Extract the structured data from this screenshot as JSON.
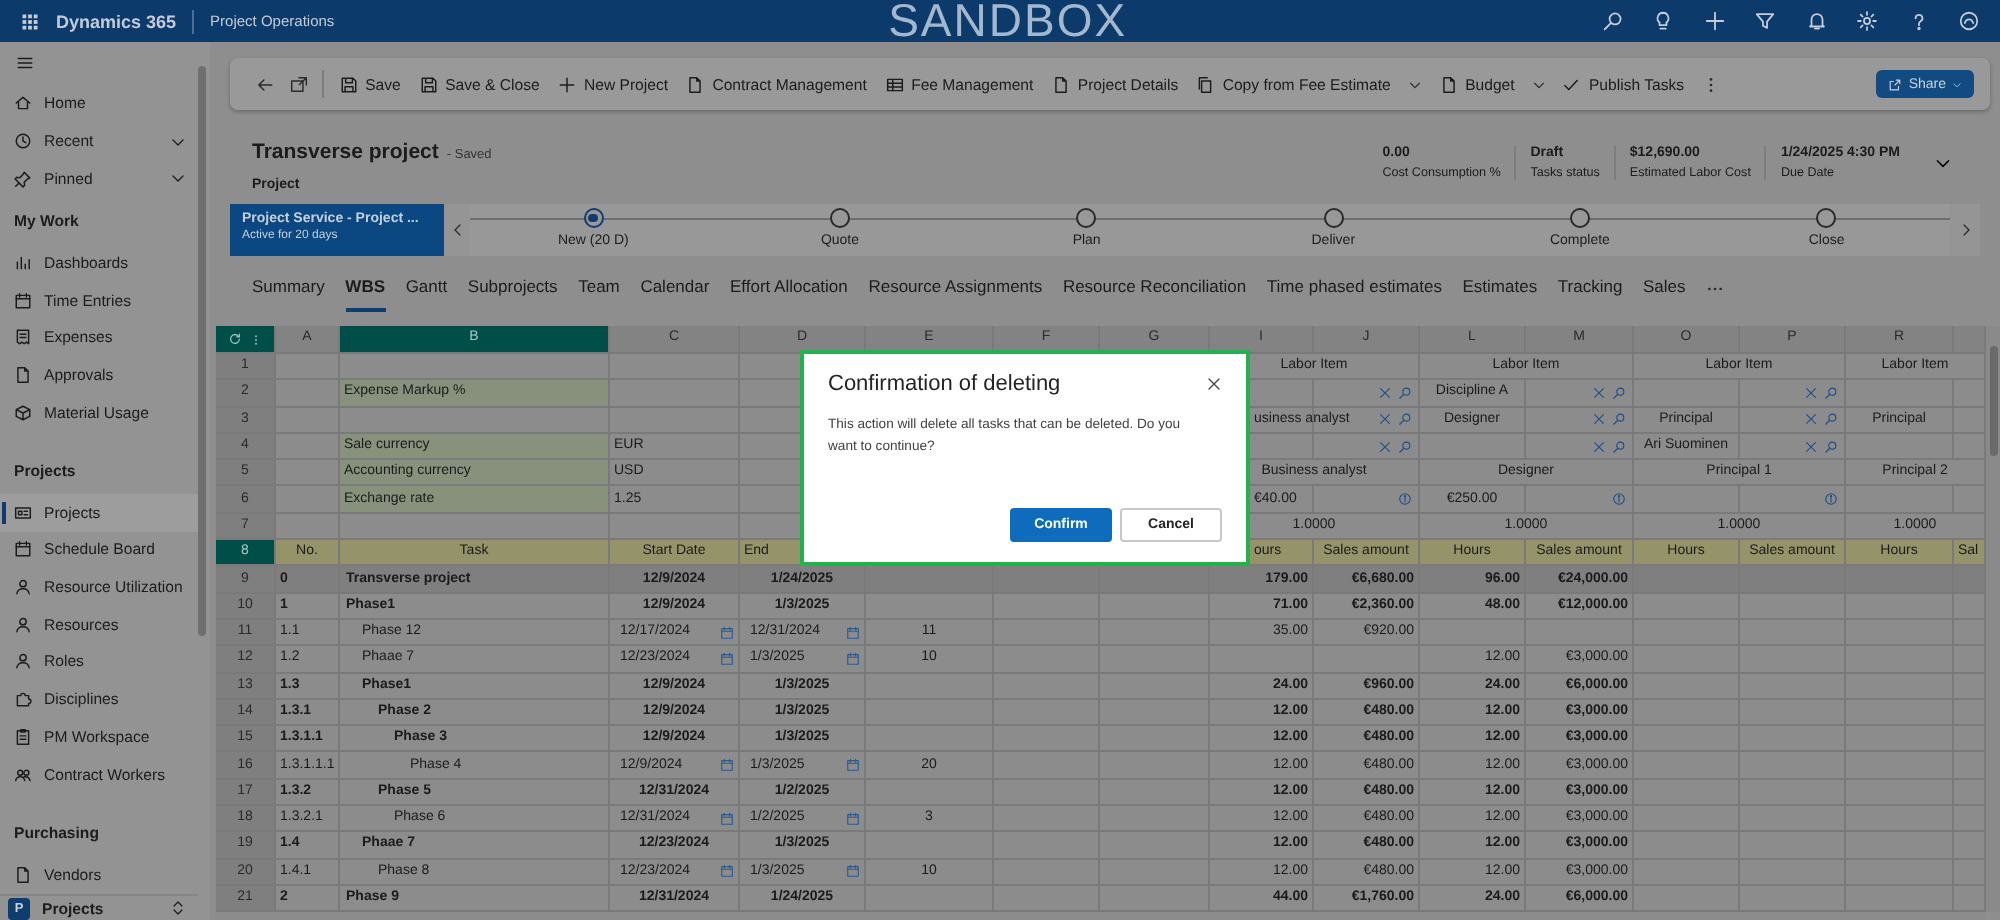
{
  "top_bar": {
    "app_name": "Dynamics 365",
    "area": "Project Operations",
    "environment": "SANDBOX"
  },
  "sidebar": {
    "items": [
      {
        "kind": "item",
        "label": "Home",
        "selected": false
      },
      {
        "kind": "expander",
        "label": "Recent",
        "selected": false
      },
      {
        "kind": "expander",
        "label": "Pinned",
        "selected": false
      },
      {
        "kind": "heading",
        "label": "My Work"
      },
      {
        "kind": "item",
        "label": "Dashboards",
        "selected": false
      },
      {
        "kind": "item",
        "label": "Time Entries",
        "selected": false
      },
      {
        "kind": "item",
        "label": "Expenses",
        "selected": false
      },
      {
        "kind": "item",
        "label": "Approvals",
        "selected": false
      },
      {
        "kind": "item",
        "label": "Material Usage",
        "selected": false
      },
      {
        "kind": "heading",
        "label": "Projects"
      },
      {
        "kind": "item",
        "label": "Projects",
        "selected": true
      },
      {
        "kind": "item",
        "label": "Schedule Board",
        "selected": false
      },
      {
        "kind": "item",
        "label": "Resource Utilization",
        "selected": false
      },
      {
        "kind": "item",
        "label": "Resources",
        "selected": false
      },
      {
        "kind": "item",
        "label": "Roles",
        "selected": false
      },
      {
        "kind": "item",
        "label": "Disciplines",
        "selected": false
      },
      {
        "kind": "item",
        "label": "PM Workspace",
        "selected": false
      },
      {
        "kind": "item",
        "label": "Contract Workers",
        "selected": false
      },
      {
        "kind": "heading",
        "label": "Purchasing"
      },
      {
        "kind": "item",
        "label": "Vendors",
        "selected": false
      }
    ],
    "area_switcher": {
      "initial": "P",
      "label": "Projects"
    }
  },
  "command_bar": {
    "commands": [
      {
        "label": "Save",
        "kind": "button"
      },
      {
        "label": "Save & Close",
        "kind": "button"
      },
      {
        "label": "New Project",
        "kind": "button"
      },
      {
        "label": "Contract Management",
        "kind": "button"
      },
      {
        "label": "Fee Management",
        "kind": "button"
      },
      {
        "label": "Project Details",
        "kind": "button"
      },
      {
        "label": "Copy from Fee Estimate",
        "kind": "split"
      },
      {
        "label": "Budget",
        "kind": "split"
      },
      {
        "label": "Publish Tasks",
        "kind": "button"
      }
    ],
    "share": "Share"
  },
  "record": {
    "title": "Transverse project",
    "save_state": "- Saved",
    "entity": "Project",
    "fields": [
      {
        "value": "0.00",
        "label": "Cost Consumption %"
      },
      {
        "value": "Draft",
        "label": "Tasks status"
      },
      {
        "value": "$12,690.00",
        "label": "Estimated Labor Cost"
      },
      {
        "value": "1/24/2025 4:30 PM",
        "label": "Due Date"
      }
    ]
  },
  "process": {
    "active_process": "Project Service - Project ...",
    "active_for": "Active for 20 days",
    "stages": [
      {
        "label": "New (20 D)",
        "selected": true
      },
      {
        "label": "Quote",
        "selected": false
      },
      {
        "label": "Plan",
        "selected": false
      },
      {
        "label": "Deliver",
        "selected": false
      },
      {
        "label": "Complete",
        "selected": false
      },
      {
        "label": "Close",
        "selected": false
      }
    ]
  },
  "tabs": [
    {
      "label": "Summary",
      "selected": false
    },
    {
      "label": "WBS",
      "selected": true
    },
    {
      "label": "Gantt",
      "selected": false
    },
    {
      "label": "Subprojects",
      "selected": false
    },
    {
      "label": "Team",
      "selected": false
    },
    {
      "label": "Calendar",
      "selected": false
    },
    {
      "label": "Effort Allocation",
      "selected": false
    },
    {
      "label": "Resource Assignments",
      "selected": false
    },
    {
      "label": "Resource Reconciliation",
      "selected": false
    },
    {
      "label": "Time phased estimates",
      "selected": false
    },
    {
      "label": "Estimates",
      "selected": false
    },
    {
      "label": "Tracking",
      "selected": false
    },
    {
      "label": "Sales",
      "selected": false
    }
  ],
  "grid": {
    "columns": [
      {
        "letter": "A",
        "selected": false
      },
      {
        "letter": "B",
        "selected": true
      },
      {
        "letter": "C",
        "selected": false
      },
      {
        "letter": "D",
        "selected": false
      },
      {
        "letter": "E",
        "selected": false
      },
      {
        "letter": "F",
        "selected": false
      },
      {
        "letter": "G",
        "selected": false
      },
      {
        "letter": "I",
        "selected": false
      },
      {
        "letter": "J",
        "selected": false
      },
      {
        "letter": "L",
        "selected": false
      },
      {
        "letter": "M",
        "selected": false
      },
      {
        "letter": "O",
        "selected": false
      },
      {
        "letter": "P",
        "selected": false
      },
      {
        "letter": "R",
        "selected": false
      }
    ],
    "rows": [
      {
        "row": "1",
        "selected": false,
        "kind": "plain",
        "cells": [
          null,
          null,
          null,
          null,
          null,
          null,
          null,
          {
            "kind": "wide",
            "text": "Labor Item"
          },
          {
            "kind": "wide",
            "text": "Labor Item"
          },
          {
            "kind": "wide",
            "text": "Labor Item"
          },
          {
            "kind": "wide",
            "text": "Labor Item"
          }
        ]
      },
      {
        "row": "2",
        "selected": false,
        "kind": "plain",
        "cells": [
          null,
          {
            "kind": "label",
            "text": "Expense Markup %"
          },
          null,
          null,
          null,
          null,
          null,
          null,
          {
            "kind": "lookup"
          },
          {
            "kind": "text",
            "text": "Discipline A"
          },
          {
            "kind": "lookup"
          },
          null,
          {
            "kind": "lookup"
          }
        ]
      },
      {
        "row": "3",
        "selected": false,
        "kind": "plain",
        "cells": [
          null,
          null,
          null,
          null,
          null,
          null,
          null,
          {
            "kind": "clipped",
            "text": "usiness analyst"
          },
          {
            "kind": "lookup"
          },
          {
            "kind": "text",
            "text": "Designer"
          },
          {
            "kind": "lookup"
          },
          {
            "kind": "text",
            "text": "Principal"
          },
          {
            "kind": "lookup"
          },
          {
            "kind": "text",
            "text": "Principal"
          }
        ]
      },
      {
        "row": "4",
        "selected": false,
        "kind": "plain",
        "cells": [
          null,
          {
            "kind": "label",
            "text": "Sale currency"
          },
          {
            "kind": "text",
            "text": "EUR"
          },
          null,
          null,
          null,
          null,
          null,
          {
            "kind": "lookup"
          },
          null,
          {
            "kind": "lookup"
          },
          {
            "kind": "text",
            "text": "Ari Suominen"
          },
          {
            "kind": "lookup"
          }
        ]
      },
      {
        "row": "5",
        "selected": false,
        "kind": "plain",
        "cells": [
          null,
          {
            "kind": "label",
            "text": "Accounting currency"
          },
          {
            "kind": "text",
            "text": "USD"
          },
          null,
          null,
          null,
          null,
          {
            "kind": "wide",
            "text": "Business analyst"
          },
          {
            "kind": "wide",
            "text": "Designer"
          },
          {
            "kind": "wide",
            "text": "Principal 1"
          },
          {
            "kind": "wide",
            "text": "Principal 2"
          }
        ]
      },
      {
        "row": "6",
        "selected": false,
        "kind": "plain",
        "cells": [
          null,
          {
            "kind": "label",
            "text": "Exchange rate"
          },
          {
            "kind": "text",
            "text": "1.25"
          },
          null,
          null,
          null,
          null,
          {
            "kind": "clipped",
            "text": "€40.00"
          },
          {
            "kind": "info"
          },
          {
            "kind": "text",
            "text": "€250.00"
          },
          {
            "kind": "info"
          },
          null,
          {
            "kind": "info"
          }
        ]
      },
      {
        "row": "7",
        "selected": false,
        "kind": "plain",
        "cells": [
          null,
          null,
          null,
          null,
          null,
          null,
          null,
          {
            "kind": "wide",
            "text": "1.0000"
          },
          {
            "kind": "wide",
            "text": "1.0000"
          },
          {
            "kind": "wide",
            "text": "1.0000"
          },
          {
            "kind": "wide",
            "text": "1.0000"
          }
        ]
      },
      {
        "row": "8",
        "selected": true,
        "kind": "header",
        "cells": [
          {
            "kind": "text",
            "text": "No."
          },
          {
            "kind": "text",
            "text": "Task"
          },
          {
            "kind": "text",
            "text": "Start Date"
          },
          {
            "kind": "partial",
            "text": "End"
          },
          null,
          null,
          null,
          {
            "kind": "clipped",
            "text": "ours"
          },
          {
            "kind": "text",
            "text": "Sales amount"
          },
          {
            "kind": "text",
            "text": "Hours"
          },
          {
            "kind": "text",
            "text": "Sales amount"
          },
          {
            "kind": "text",
            "text": "Hours"
          },
          {
            "kind": "text",
            "text": "Sales amount"
          },
          {
            "kind": "text",
            "text": "Hours"
          },
          {
            "kind": "partial",
            "text": "Sal"
          }
        ]
      }
    ],
    "tasks": [
      {
        "row": "9",
        "selected": false,
        "kind": "project",
        "no": "0",
        "task": "Transverse project",
        "start": "12/9/2024",
        "end": "1/24/2025",
        "hours": "179.00",
        "sales": "€6,680.00",
        "hours_2": "96.00",
        "sales_2": "€24,000.00",
        "children": [
          {
            "row": "10",
            "selected": false,
            "kind": "summary",
            "no": "1",
            "task": "Phase1",
            "start": "12/9/2024",
            "end": "1/3/2025",
            "hours": "71.00",
            "sales": "€2,360.00",
            "hours_2": "48.00",
            "sales_2": "€12,000.00",
            "children": [
              {
                "row": "11",
                "selected": false,
                "kind": "task",
                "no": "1.1",
                "task": "Phase 12",
                "start": "12/17/2024",
                "end": "12/31/2024",
                "column_e": "11",
                "hours": "35.00",
                "sales": "€920.00"
              },
              {
                "row": "12",
                "selected": false,
                "kind": "task",
                "no": "1.2",
                "task": "Phaae 7",
                "start": "12/23/2024",
                "end": "1/3/2025",
                "column_e": "10",
                "hours_2": "12.00",
                "sales_2": "€3,000.00"
              },
              {
                "row": "13",
                "selected": false,
                "kind": "summary",
                "no": "1.3",
                "task": "Phase1",
                "start": "12/9/2024",
                "end": "1/3/2025",
                "hours": "24.00",
                "sales": "€960.00",
                "hours_2": "24.00",
                "sales_2": "€6,000.00",
                "children": [
                  {
                    "row": "14",
                    "selected": false,
                    "kind": "summary",
                    "no": "1.3.1",
                    "task": "Phase 2",
                    "start": "12/9/2024",
                    "end": "1/3/2025",
                    "hours": "12.00",
                    "sales": "€480.00",
                    "hours_2": "12.00",
                    "sales_2": "€3,000.00",
                    "children": [
                      {
                        "row": "15",
                        "selected": false,
                        "kind": "summary",
                        "no": "1.3.1.1",
                        "task": "Phase 3",
                        "start": "12/9/2024",
                        "end": "1/3/2025",
                        "hours": "12.00",
                        "sales": "€480.00",
                        "hours_2": "12.00",
                        "sales_2": "€3,000.00",
                        "children": [
                          {
                            "row": "16",
                            "selected": false,
                            "kind": "task",
                            "no": "1.3.1.1.1",
                            "task": "Phase 4",
                            "start": "12/9/2024",
                            "end": "1/3/2025",
                            "column_e": "20",
                            "hours": "12.00",
                            "sales": "€480.00",
                            "hours_2": "12.00",
                            "sales_2": "€3,000.00"
                          }
                        ]
                      }
                    ]
                  },
                  {
                    "row": "17",
                    "selected": false,
                    "kind": "summary",
                    "no": "1.3.2",
                    "task": "Phase 5",
                    "start": "12/31/2024",
                    "end": "1/2/2025",
                    "hours": "12.00",
                    "sales": "€480.00",
                    "hours_2": "12.00",
                    "sales_2": "€3,000.00",
                    "children": [
                      {
                        "row": "18",
                        "selected": false,
                        "kind": "task",
                        "no": "1.3.2.1",
                        "task": "Phase 6",
                        "start": "12/31/2024",
                        "end": "1/2/2025",
                        "column_e": "3",
                        "hours": "12.00",
                        "sales": "€480.00",
                        "hours_2": "12.00",
                        "sales_2": "€3,000.00"
                      }
                    ]
                  }
                ]
              },
              {
                "row": "19",
                "selected": false,
                "kind": "summary",
                "no": "1.4",
                "task": "Phaae 7",
                "start": "12/23/2024",
                "end": "1/3/2025",
                "hours": "12.00",
                "sales": "€480.00",
                "hours_2": "12.00",
                "sales_2": "€3,000.00",
                "children": [
                  {
                    "row": "20",
                    "selected": false,
                    "kind": "task",
                    "no": "1.4.1",
                    "task": "Phase 8",
                    "start": "12/23/2024",
                    "end": "1/3/2025",
                    "column_e": "10",
                    "hours": "12.00",
                    "sales": "€480.00",
                    "hours_2": "12.00",
                    "sales_2": "€3,000.00"
                  }
                ]
              }
            ]
          },
          {
            "row": "21",
            "selected": false,
            "kind": "summary",
            "no": "2",
            "task": "Phase 9",
            "start": "12/31/2024",
            "end": "1/24/2025",
            "hours": "44.00",
            "sales": "€1,760.00",
            "hours_2": "24.00",
            "sales_2": "€6,000.00"
          }
        ]
      }
    ]
  },
  "dialog": {
    "title": "Confirmation of deleting",
    "message": "This action will delete all tasks that can be deleted. Do you want to continue?",
    "buttons": [
      {
        "label": "Confirm",
        "kind": "primary"
      },
      {
        "label": "Cancel",
        "kind": "secondary"
      }
    ]
  }
}
